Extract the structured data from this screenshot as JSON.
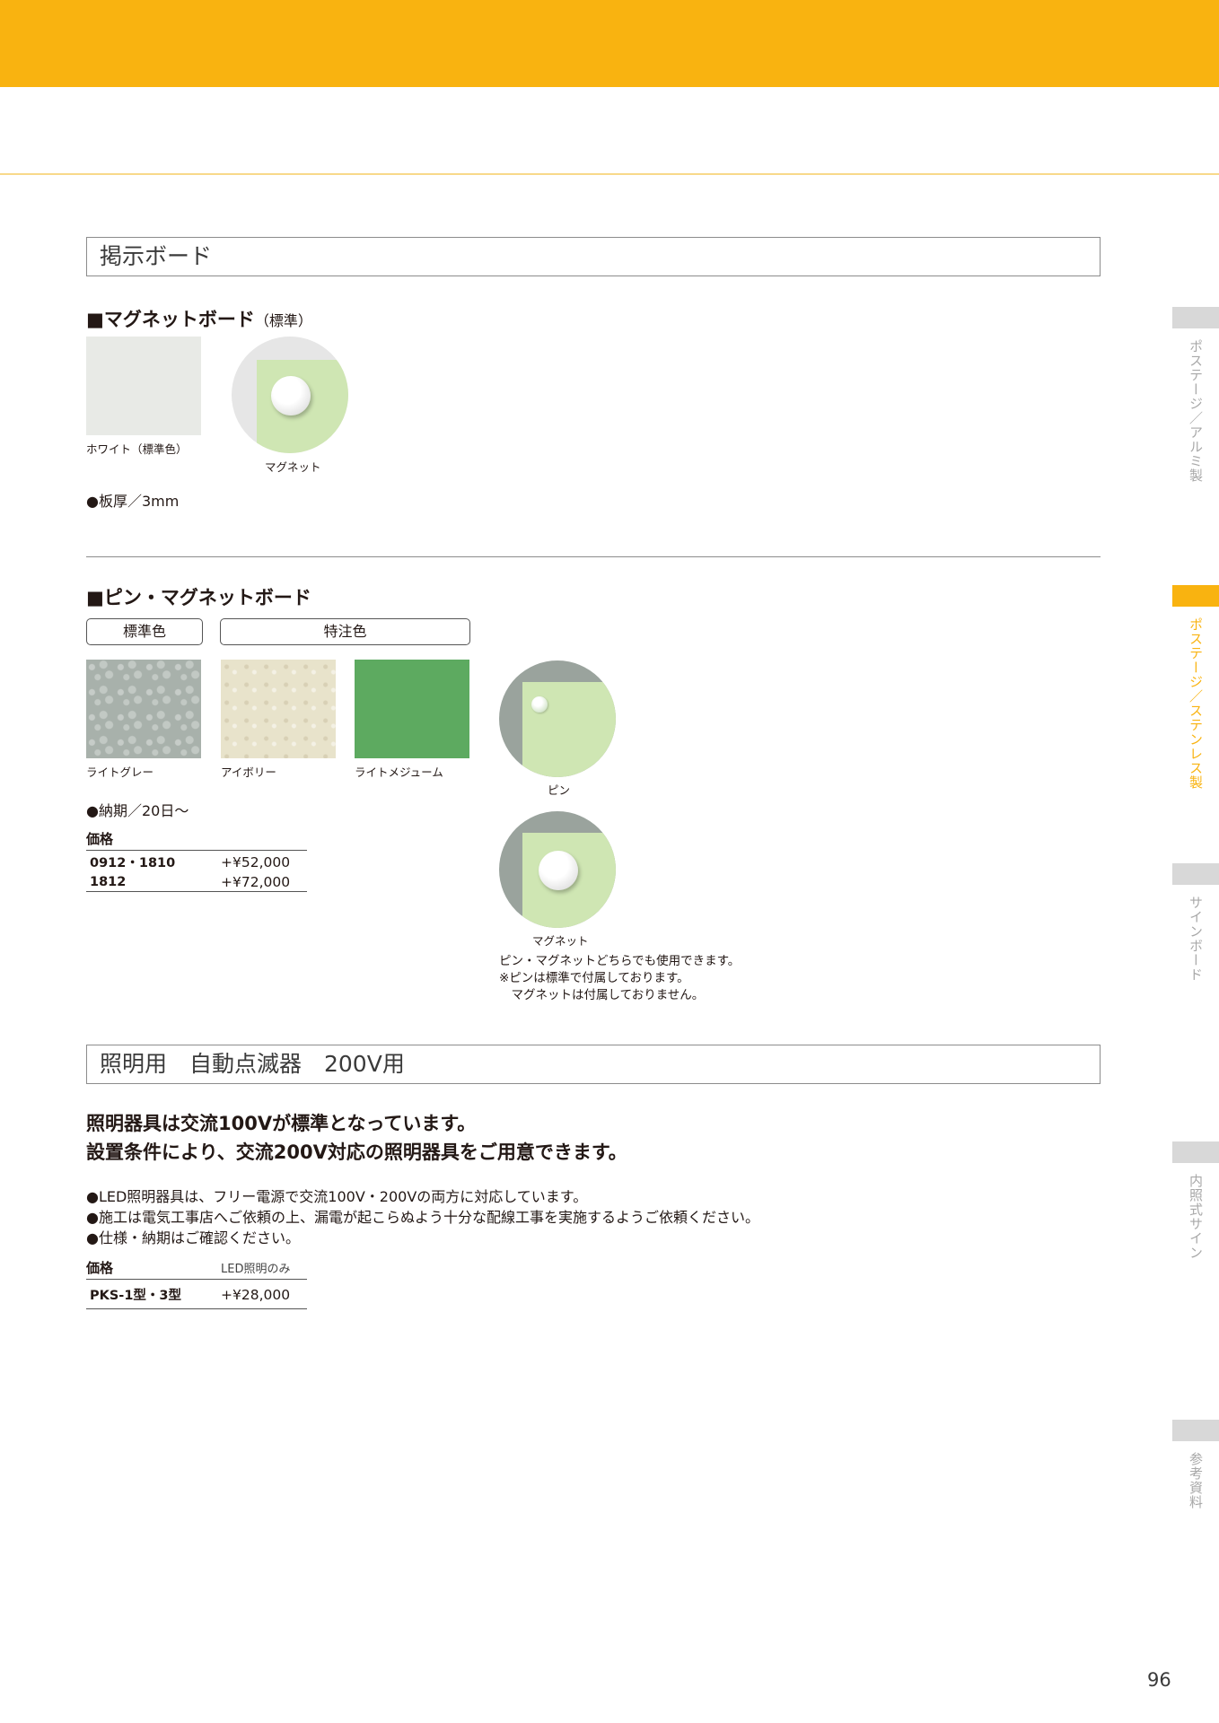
{
  "sections": {
    "board": "掲示ボード",
    "timer": "照明用　自動点滅器　200V用"
  },
  "magnet_board": {
    "heading": "■マグネットボード",
    "heading_sub": "（標準）",
    "white_label": "ホワイト（標準色）",
    "magnet_label": "マグネット",
    "thickness": "●板厚／3mm"
  },
  "pin_board": {
    "heading": "■ピン・マグネットボード",
    "tag_standard": "標準色",
    "tag_special": "特注色",
    "swatches": [
      "ライトグレー",
      "アイボリー",
      "ライトメジューム"
    ],
    "pin_label": "ピン",
    "magnet_label": "マグネット",
    "delivery": "●納期／20日～",
    "price_header": "価格",
    "prices": [
      {
        "model": "0912・1810",
        "price": "+¥52,000"
      },
      {
        "model": "1812",
        "price": "+¥72,000"
      }
    ],
    "notes": [
      "ピン・マグネットどちらでも使用できます。",
      "※ピンは標準で付属しております。",
      "　マグネットは付属しておりません。"
    ]
  },
  "timer": {
    "lead1": "照明器具は交流100Vが標準となっています。",
    "lead2": "設置条件により、交流200V対応の照明器具をご用意できます。",
    "bullets": [
      "●LED照明器具は、フリー電源で交流100V・200Vの両方に対応しています。",
      "●施工は電気工事店へご依頼の上、漏電が起こらぬよう十分な配線工事を実施するようご依頼ください。",
      "●仕様・納期はご確認ください。"
    ],
    "price_header": "価格",
    "price_sub": "LED照明のみ",
    "prices": [
      {
        "model": "PKS-1型・3型",
        "price": "+¥28,000"
      }
    ]
  },
  "side_nav": [
    {
      "label": "ポステージ／アルミ製",
      "active": false
    },
    {
      "label": "ポステージ／ステンレス製",
      "active": true
    },
    {
      "label": "サインボード",
      "active": false
    },
    {
      "label": "内照式サイン",
      "active": false
    },
    {
      "label": "参考資料",
      "active": false
    }
  ],
  "colors": {
    "accent": "#f9b310",
    "white_board": "#e8eae6",
    "light_grey": "#a8b1ab",
    "ivory": "#e8e3cb",
    "light_medium": "#5daa60"
  },
  "page_number": "96"
}
